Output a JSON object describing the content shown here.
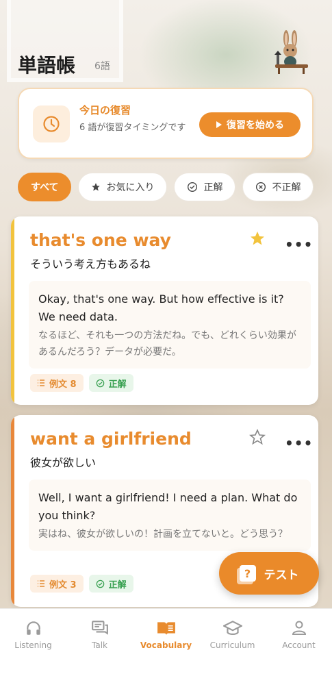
{
  "header": {
    "title": "単語帳",
    "count": "6語"
  },
  "review": {
    "title": "今日の復習",
    "subtitle": "6 語が復習タイミングです",
    "button": "復習を始める"
  },
  "filters": [
    {
      "label": "すべて",
      "icon": ""
    },
    {
      "label": "お気に入り",
      "icon": "star-icon"
    },
    {
      "label": "正解",
      "icon": "check-circle-icon"
    },
    {
      "label": "不正解",
      "icon": "x-circle-icon"
    }
  ],
  "cards": [
    {
      "word": "that's one way",
      "meaning": "そういう考え方もあるね",
      "example_en": "Okay, that's one way. But how effective is it? We need data.",
      "example_jp": "なるほど、それも一つの方法だね。でも、どれくらい効果があるんだろう？データが必要だ。",
      "example_count": "例文 8",
      "status": "正解",
      "favorite": true,
      "accent": "#f2c33d"
    },
    {
      "word": "want a girlfriend",
      "meaning": "彼女が欲しい",
      "example_en": "Well, I want a girlfriend! I need a plan. What do you think?",
      "example_jp": "実はね、彼女が欲しいの！計画を立てないと。どう思う？",
      "example_count": "例文 3",
      "status": "正解",
      "favorite": false,
      "accent": "#e8873a"
    }
  ],
  "fab": {
    "label": "テスト"
  },
  "nav": [
    {
      "label": "Listening",
      "icon": "headphones-icon"
    },
    {
      "label": "Talk",
      "icon": "chat-icon"
    },
    {
      "label": "Vocabulary",
      "icon": "book-icon"
    },
    {
      "label": "Curriculum",
      "icon": "graduation-cap-icon"
    },
    {
      "label": "Account",
      "icon": "person-icon"
    }
  ],
  "colors": {
    "accent": "#ec8d2c",
    "success": "#3aa152",
    "star": "#f2c33d"
  }
}
